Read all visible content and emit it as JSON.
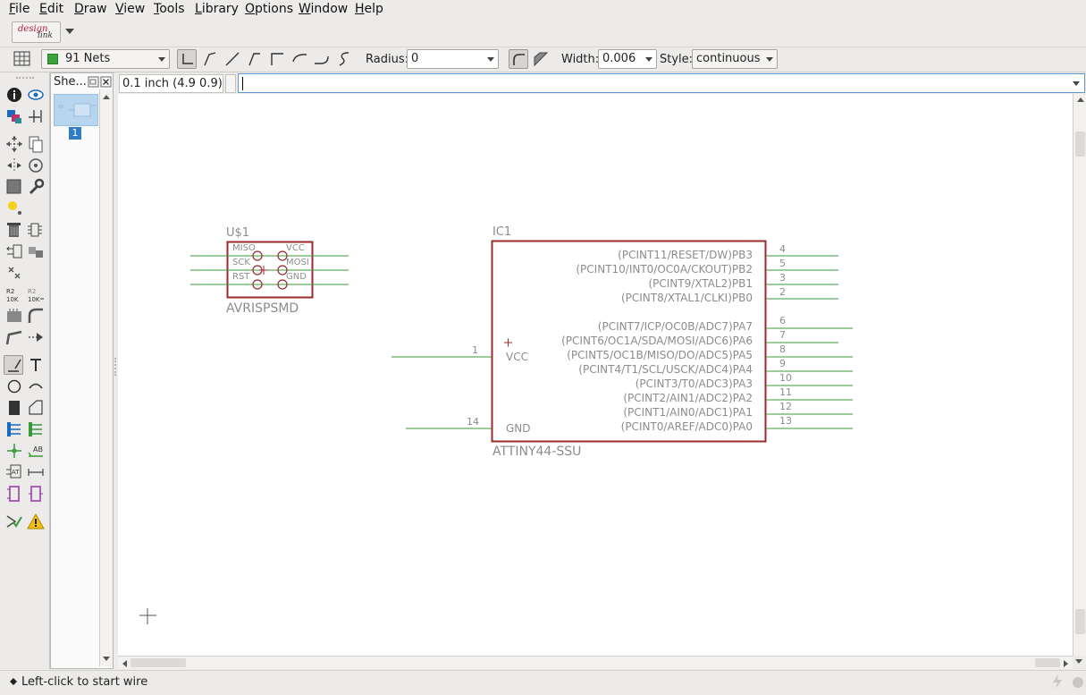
{
  "menubar": {
    "items": [
      "File",
      "Edit",
      "Draw",
      "View",
      "Tools",
      "Library",
      "Options",
      "Window",
      "Help"
    ]
  },
  "designlink": {
    "line1": "design",
    "line2": "link"
  },
  "toolbar": {
    "net_class": "91 Nets",
    "radius_label": "Radius:",
    "radius_value": "0",
    "width_label": "Width:",
    "width_value": "0.006",
    "style_label": "Style:",
    "style_value": "continuous",
    "net_color": "#3aa33a"
  },
  "sheets_panel": {
    "title": "She...",
    "sheet_number": "1"
  },
  "command": {
    "grid_readout": "0.1 inch (4.9 0.9)",
    "input_value": ""
  },
  "status": {
    "message": "Left-click to start wire"
  },
  "schematic": {
    "colors": {
      "outline": "#9a2b2b",
      "wire": "#3a9a3a",
      "text": "#8c8c8c",
      "origin": "#9a2b2b"
    },
    "u1": {
      "name": "U$1",
      "value": "AVRISPSMD",
      "left_pins": [
        "MISO",
        "SCK",
        "RST"
      ],
      "right_pins": [
        "VCC",
        "MOSI",
        "GND"
      ]
    },
    "ic1": {
      "name": "IC1",
      "value": "ATTINY44-SSU",
      "left_pins": [
        {
          "label": "VCC",
          "number": "1"
        },
        {
          "label": "GND",
          "number": "14"
        }
      ],
      "right_pins": [
        {
          "label": "(PCINT11/RESET/DW)PB3",
          "number": "4"
        },
        {
          "label": "(PCINT10/INT0/OC0A/CKOUT)PB2",
          "number": "5"
        },
        {
          "label": "(PCINT9/XTAL2)PB1",
          "number": "3"
        },
        {
          "label": "(PCINT8/XTAL1/CLKI)PB0",
          "number": "2"
        },
        {
          "label": "(PCINT7/ICP/OC0B/ADC7)PA7",
          "number": "6"
        },
        {
          "label": "(PCINT6/OC1A/SDA/MOSI/ADC6)PA6",
          "number": "7"
        },
        {
          "label": "(PCINT5/OC1B/MISO/DO/ADC5)PA5",
          "number": "8"
        },
        {
          "label": "(PCINT4/T1/SCL/USCK/ADC4)PA4",
          "number": "9"
        },
        {
          "label": "(PCINT3/T0/ADC3)PA3",
          "number": "10"
        },
        {
          "label": "(PCINT2/AIN1/ADC2)PA2",
          "number": "11"
        },
        {
          "label": "(PCINT1/AIN0/ADC1)PA1",
          "number": "12"
        },
        {
          "label": "(PCINT0/AREF/ADC0)PA0",
          "number": "13"
        }
      ]
    }
  }
}
